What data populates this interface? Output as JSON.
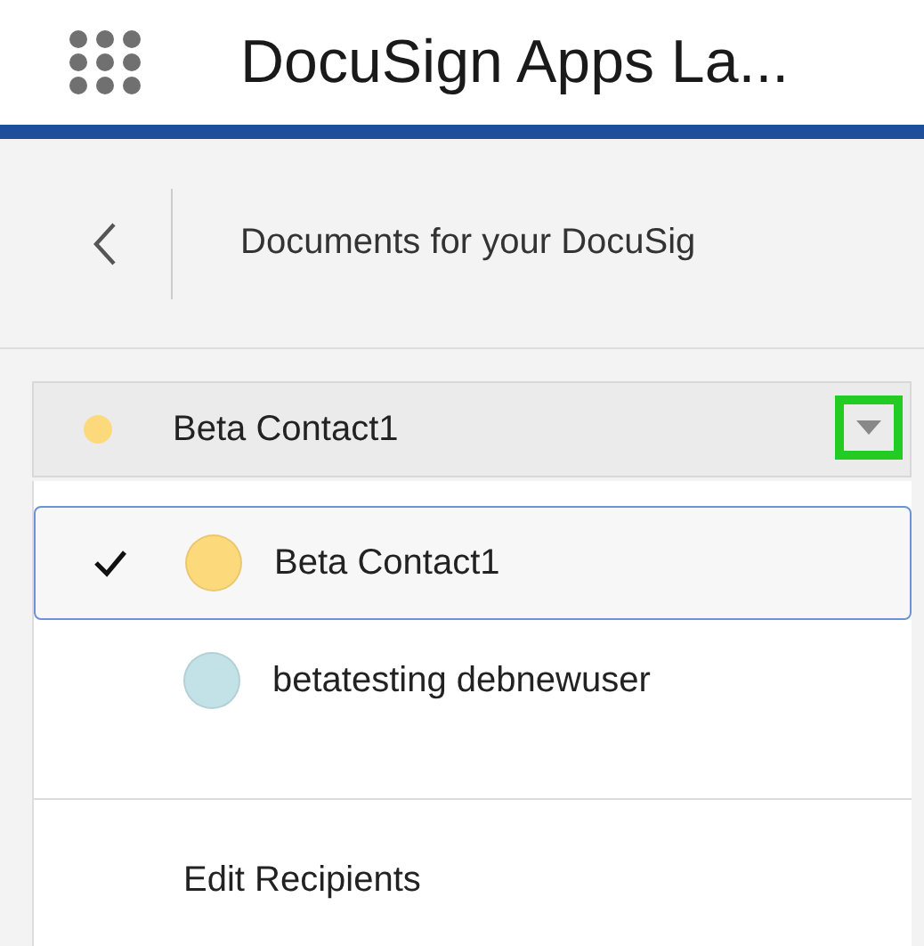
{
  "app_header": {
    "title": "DocuSign Apps La..."
  },
  "sub_header": {
    "title": "Documents for your DocuSig"
  },
  "recipient_select": {
    "value": "Beta Contact1",
    "color": "#fcd97a",
    "highlighted": true
  },
  "menu": {
    "items": [
      {
        "label": "Beta Contact1",
        "color": "#fcd97a",
        "selected": true
      },
      {
        "label": "betatesting debnewuser",
        "color": "#c3e2e8",
        "selected": false
      }
    ],
    "action": "Edit Recipients"
  }
}
